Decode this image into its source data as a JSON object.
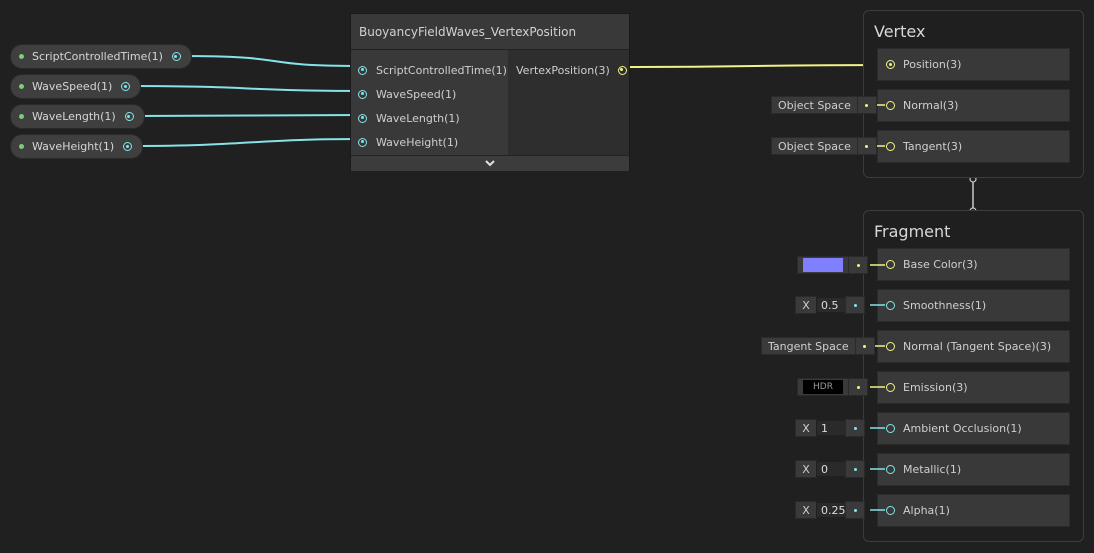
{
  "colors": {
    "background": "#202020",
    "float_port": "#84e4e7",
    "vector3_port": "#f2f286",
    "property_dot": "#7ecb7a",
    "base_color_swatch": "#8080ff"
  },
  "properties": [
    {
      "label": "ScriptControlledTime(1)"
    },
    {
      "label": "WaveSpeed(1)"
    },
    {
      "label": "WaveLength(1)"
    },
    {
      "label": "WaveHeight(1)"
    }
  ],
  "subgraph": {
    "title": "BuoyancyFieldWaves_VertexPosition",
    "inputs": [
      {
        "label": "ScriptControlledTime(1)"
      },
      {
        "label": "WaveSpeed(1)"
      },
      {
        "label": "WaveLength(1)"
      },
      {
        "label": "WaveHeight(1)"
      }
    ],
    "outputs": [
      {
        "label": "VertexPosition(3)"
      }
    ],
    "expand_icon": "chevron-down-icon"
  },
  "vertex": {
    "title": "Vertex",
    "blocks": [
      {
        "label": "Position(3)",
        "type": "vector3",
        "connected": true
      },
      {
        "label": "Normal(3)",
        "type": "vector3",
        "inline": "Object Space"
      },
      {
        "label": "Tangent(3)",
        "type": "vector3",
        "inline": "Object Space"
      }
    ]
  },
  "fragment": {
    "title": "Fragment",
    "blocks": [
      {
        "label": "Base Color(3)",
        "type": "vector3",
        "inline_kind": "color",
        "color": "#8080ff"
      },
      {
        "label": "Smoothness(1)",
        "type": "float",
        "inline_kind": "number",
        "axis": "X",
        "value": "0.5"
      },
      {
        "label": "Normal (Tangent Space)(3)",
        "type": "vector3",
        "inline_kind": "text",
        "text": "Tangent Space"
      },
      {
        "label": "Emission(3)",
        "type": "vector3",
        "inline_kind": "hdr",
        "text": "HDR"
      },
      {
        "label": "Ambient Occlusion(1)",
        "type": "float",
        "inline_kind": "number",
        "axis": "X",
        "value": "1"
      },
      {
        "label": "Metallic(1)",
        "type": "float",
        "inline_kind": "number",
        "axis": "X",
        "value": "0"
      },
      {
        "label": "Alpha(1)",
        "type": "float",
        "inline_kind": "number",
        "axis": "X",
        "value": "0.25"
      }
    ]
  }
}
